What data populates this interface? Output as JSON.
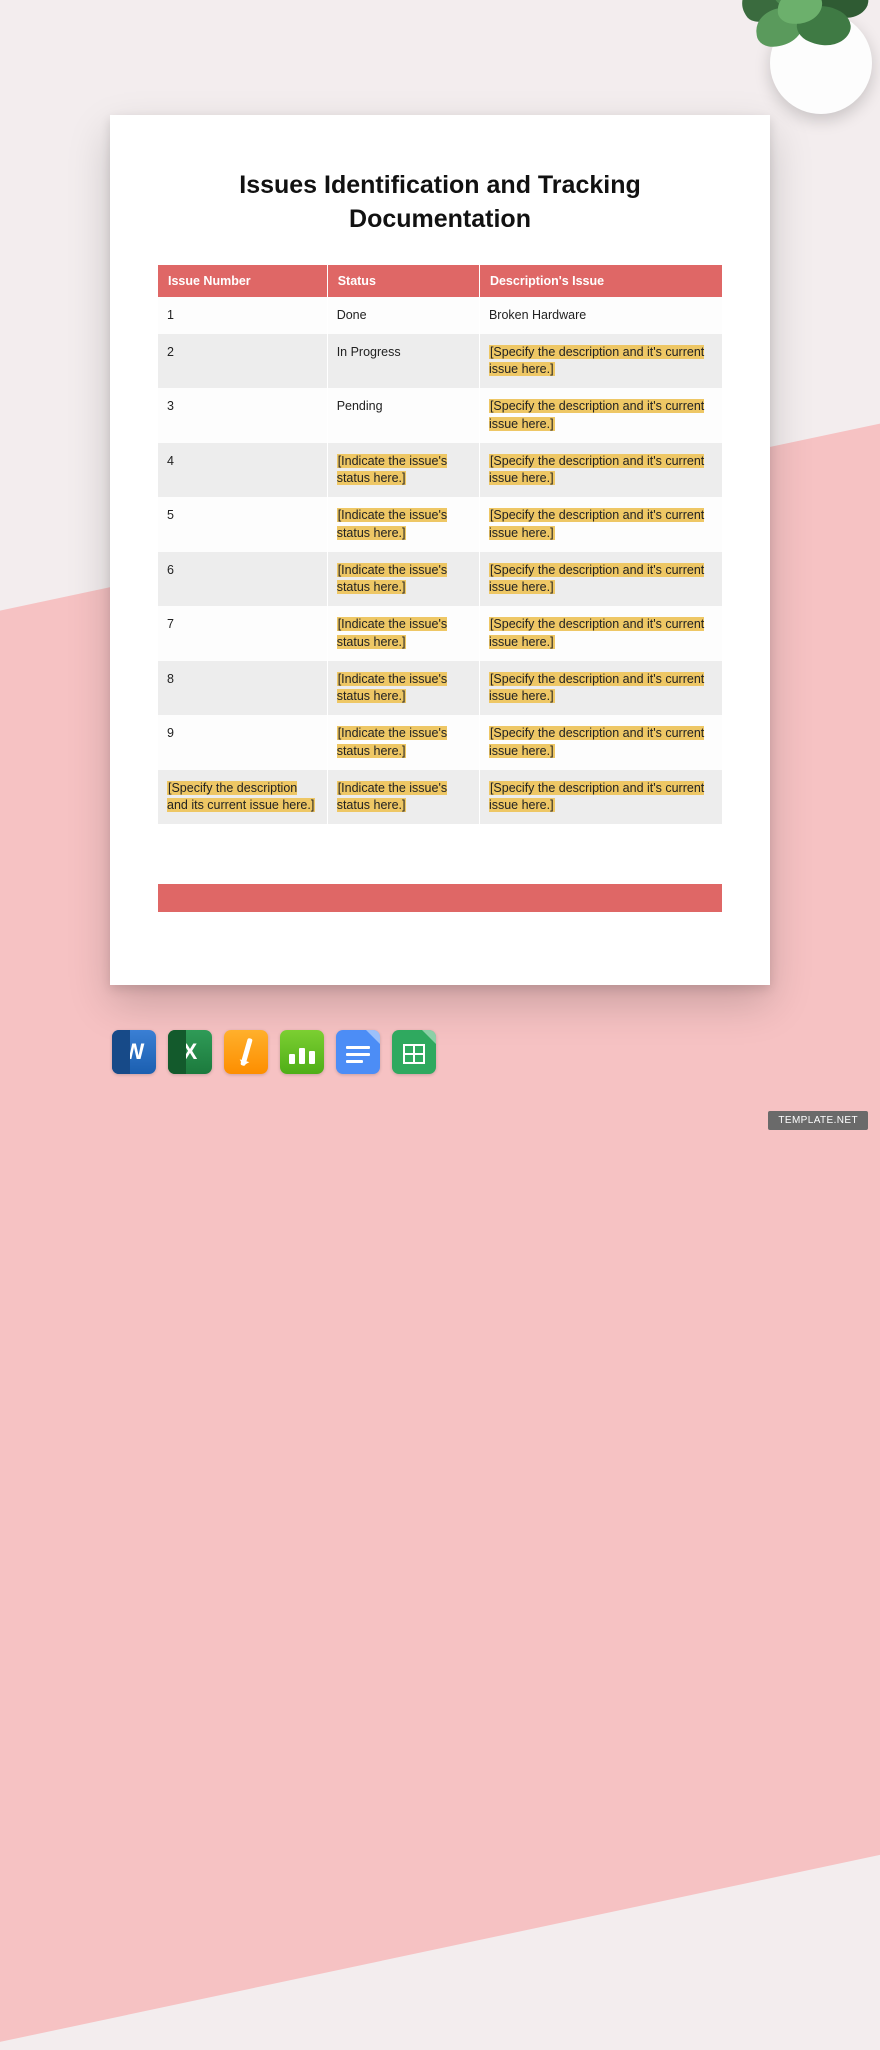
{
  "document": {
    "title": "Issues Identification and Tracking Documentation"
  },
  "table": {
    "headers": {
      "number": "Issue Number",
      "status": "Status",
      "description": "Description's Issue"
    },
    "rows": [
      {
        "number": "1",
        "number_hl": false,
        "status": "Done",
        "status_hl": false,
        "description": "Broken Hardware",
        "description_hl": false
      },
      {
        "number": "2",
        "number_hl": false,
        "status": "In Progress",
        "status_hl": false,
        "description": "[Specify the description and it's current issue here.]",
        "description_hl": true
      },
      {
        "number": "3",
        "number_hl": false,
        "status": "Pending",
        "status_hl": false,
        "description": "[Specify the description and it's current issue here.]",
        "description_hl": true
      },
      {
        "number": "4",
        "number_hl": false,
        "status": "[Indicate the issue's status here.]",
        "status_hl": true,
        "description": "[Specify the description and it's current issue here.]",
        "description_hl": true
      },
      {
        "number": "5",
        "number_hl": false,
        "status": "[Indicate the issue's status here.]",
        "status_hl": true,
        "description": "[Specify the description and it's current issue here.]",
        "description_hl": true
      },
      {
        "number": "6",
        "number_hl": false,
        "status": "[Indicate the issue's status here.]",
        "status_hl": true,
        "description": "[Specify the description and it's current issue here.]",
        "description_hl": true
      },
      {
        "number": "7",
        "number_hl": false,
        "status": "[Indicate the issue's status here.]",
        "status_hl": true,
        "description": "[Specify the description and it's current issue here.]",
        "description_hl": true
      },
      {
        "number": "8",
        "number_hl": false,
        "status": "[Indicate the issue's status here.]",
        "status_hl": true,
        "description": "[Specify the description and it's current issue here.]",
        "description_hl": true
      },
      {
        "number": "9",
        "number_hl": false,
        "status": "[Indicate the issue's status here.]",
        "status_hl": true,
        "description": "[Specify the description and it's current issue here.]",
        "description_hl": true
      },
      {
        "number": "[Specify the description and its current issue here.]",
        "number_hl": true,
        "status": "[Indicate the issue's status here.]",
        "status_hl": true,
        "description": "[Specify the description and it's current issue here.]",
        "description_hl": true
      }
    ]
  },
  "icons": {
    "word": "W",
    "excel": "X"
  },
  "watermark": "TEMPLATE.NET"
}
